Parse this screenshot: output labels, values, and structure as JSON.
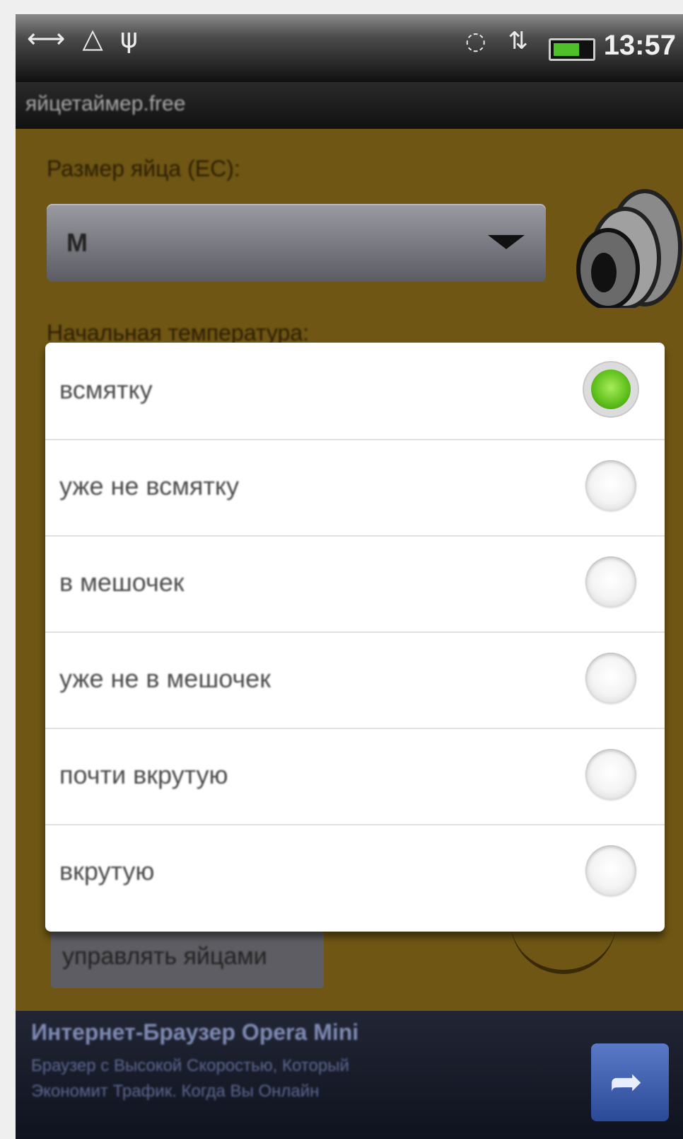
{
  "status_bar": {
    "left_icons": "⟷ △ ψ",
    "right_icons": "◌ ⇅ ▂▄",
    "time": "13:57",
    "battery_level": 0.6,
    "battery_color": "#4fbf2a"
  },
  "app": {
    "title": "яйцетаймер.free"
  },
  "form": {
    "egg_size_label": "Размер яйца (EC):",
    "egg_size_value": "M",
    "start_temp_label": "Начальная температура:"
  },
  "dialog": {
    "options": [
      {
        "label": "всмятку",
        "checked": true
      },
      {
        "label": "уже не всмятку",
        "checked": false
      },
      {
        "label": "в мешочек",
        "checked": false
      },
      {
        "label": "уже не в мешочек",
        "checked": false
      },
      {
        "label": "почти вкрутую",
        "checked": false
      },
      {
        "label": "вкрутую",
        "checked": false
      }
    ]
  },
  "bottom": {
    "button_label": "управлять яйцами"
  },
  "ad": {
    "title": "Интернет-Браузер Opera Mini",
    "line1": "Браузер с Высокой Скоростью, Который",
    "line2": "Экономит Трафик. Когда Вы Онлайн",
    "button_icon": "share-arrow-icon",
    "button_glyph": "➦"
  }
}
